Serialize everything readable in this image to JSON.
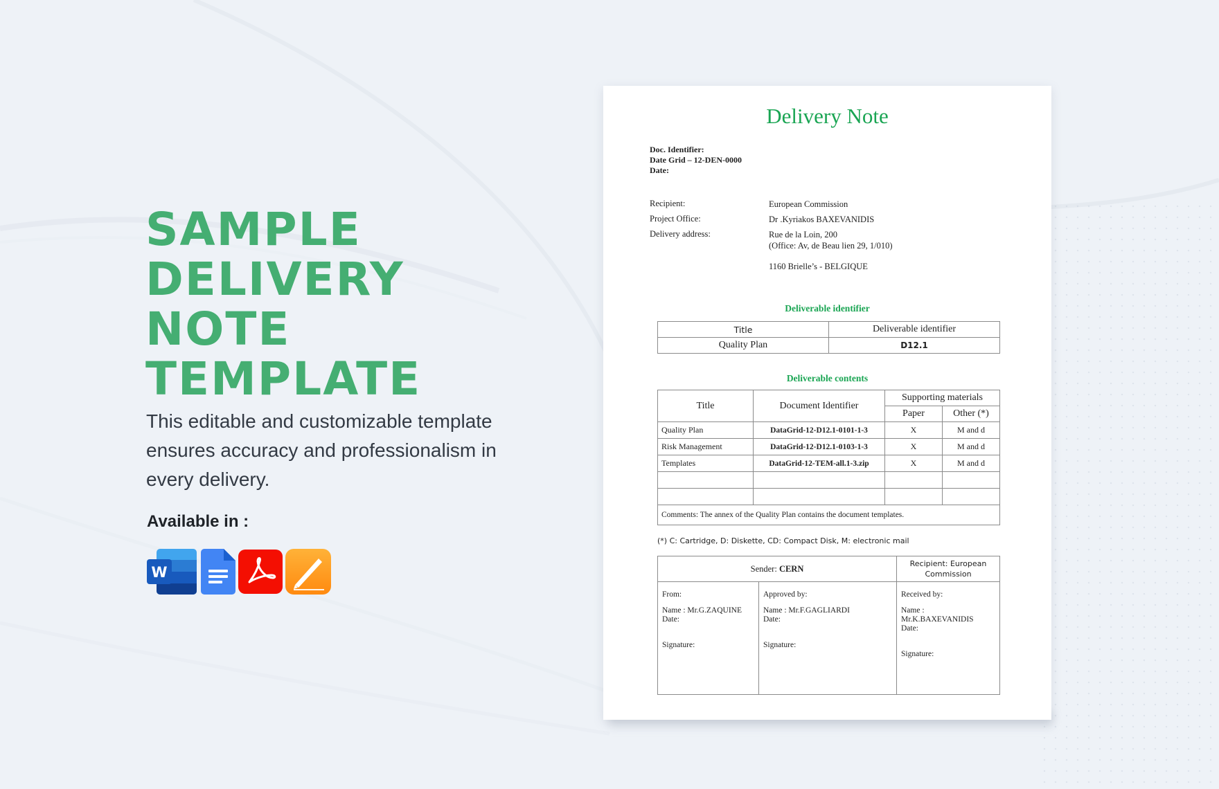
{
  "promo": {
    "headline_lines": [
      "SAMPLE",
      "DELIVERY",
      "NOTE",
      "TEMPLATE"
    ],
    "description": "This editable and customizable template ensures accuracy and professionalism in every delivery.",
    "available_label": "Available in :",
    "formats": [
      {
        "name": "Microsoft Word",
        "icon": "word-icon",
        "color": "#185abd"
      },
      {
        "name": "Google Docs",
        "icon": "google-docs-icon",
        "color": "#4285f4"
      },
      {
        "name": "Adobe PDF",
        "icon": "adobe-pdf-icon",
        "color": "#f40f02"
      },
      {
        "name": "Apple Pages",
        "icon": "apple-pages-icon",
        "color": "#ff9a1f"
      }
    ],
    "accent_color": "#45ae72"
  },
  "document": {
    "title": "Delivery Note",
    "title_color": "#1aa553",
    "meta": {
      "doc_identifier": "Doc. Identifier:",
      "date_grid": "Date Grid – 12-DEN-0000",
      "date": "Date:"
    },
    "info": [
      {
        "label": "Recipient:",
        "value": "European Commission"
      },
      {
        "label": "Project Office:",
        "value": "Dr .Kyriakos BAXEVANIDIS"
      },
      {
        "label": "Delivery address:",
        "value_lines": [
          "Rue de la Loin, 200",
          "(Office: Av, de Beau lien 29, 1/010)",
          "1160 Brielle’s - BELGIQUE"
        ]
      }
    ],
    "deliverable_identifier": {
      "section_title": "Deliverable identifier",
      "headers": [
        "Title",
        "Deliverable identifier"
      ],
      "row": [
        "Quality Plan",
        "D12.1"
      ]
    },
    "deliverable_contents": {
      "section_title": "Deliverable contents",
      "headers": {
        "title": "Title",
        "document_identifier": "Document Identifier",
        "supporting": "Supporting materials",
        "paper": "Paper",
        "other": "Other (*)"
      },
      "rows": [
        {
          "title": "Quality Plan",
          "identifier": "DataGrid-12-D12.1-0101-1-3",
          "paper": "X",
          "other": "M and d"
        },
        {
          "title": "Risk Management",
          "identifier": "DataGrid-12-D12.1-0103-1-3",
          "paper": "X",
          "other": "M and d"
        },
        {
          "title": "Templates",
          "identifier": "DataGrid-12-TEM-all.1-3.zip",
          "paper": "X",
          "other": "M and d"
        },
        {
          "title": "",
          "identifier": "",
          "paper": "",
          "other": ""
        },
        {
          "title": "",
          "identifier": "",
          "paper": "",
          "other": ""
        }
      ],
      "comments": "Comments: The annex of the Quality Plan contains the document templates."
    },
    "footnote": "(*) C: Cartridge, D: Diskette, CD: Compact Disk, M: electronic mail",
    "signatures": {
      "sender_label": "Sender: ",
      "sender_name": "CERN",
      "recipient_header": "Recipient: European Commission",
      "columns": [
        {
          "role": "From:",
          "name": "Name : Mr.G.ZAQUINE",
          "date": "Date:",
          "signature": "Signature:"
        },
        {
          "role": "Approved by:",
          "name": "Name : Mr.F.GAGLIARDI",
          "date": "Date:",
          "signature": "Signature:"
        },
        {
          "role": "Received by:",
          "name": "Name : Mr.K.BAXEVANIDIS",
          "date": "Date:",
          "signature": "Signature:"
        }
      ]
    }
  }
}
